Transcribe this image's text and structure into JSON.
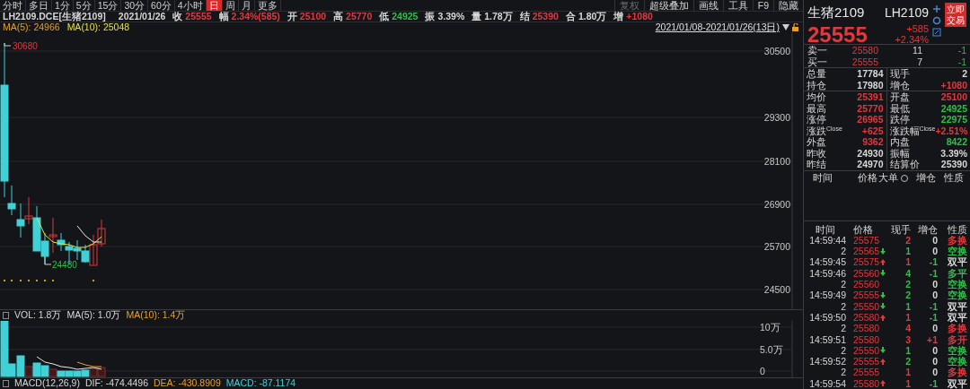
{
  "period_tabs": [
    {
      "label": "分时",
      "selected": false
    },
    {
      "label": "多日",
      "selected": false
    },
    {
      "label": "1分",
      "selected": false
    },
    {
      "label": "5分",
      "selected": false
    },
    {
      "label": "15分",
      "selected": false
    },
    {
      "label": "30分",
      "selected": false
    },
    {
      "label": "60分",
      "selected": false
    },
    {
      "label": "4小时",
      "selected": false
    },
    {
      "label": "日",
      "selected": true
    },
    {
      "label": "周",
      "selected": false
    },
    {
      "label": "月",
      "selected": false
    },
    {
      "label": "更多",
      "selected": false
    }
  ],
  "tools": [
    {
      "label": "复权",
      "disabled": true
    },
    {
      "label": "超级叠加",
      "disabled": false
    },
    {
      "label": "画线",
      "disabled": false
    },
    {
      "label": "工具",
      "disabled": false
    },
    {
      "label": "F9",
      "disabled": false
    },
    {
      "label": "隐藏",
      "disabled": false
    }
  ],
  "info_bar": {
    "symbol": "LH2109.DCE[生猪2109]",
    "date": "2021/01/26",
    "fields": [
      {
        "label": "收",
        "value": "25555",
        "color": "#e0393e"
      },
      {
        "label": "幅",
        "value": "2.34%(585)",
        "color": "#e0393e"
      },
      {
        "label": "开",
        "value": "25100",
        "color": "#e0393e"
      },
      {
        "label": "高",
        "value": "25770",
        "color": "#e0393e"
      },
      {
        "label": "低",
        "value": "24925",
        "color": "#2fbf4a"
      },
      {
        "label": "振",
        "value": "3.39%",
        "color": "#d8d8d8"
      },
      {
        "label": "量",
        "value": "1.78万",
        "color": "#d8d8d8"
      },
      {
        "label": "结",
        "value": "25390",
        "color": "#e0393e"
      },
      {
        "label": "合",
        "value": "1.80万",
        "color": "#d8d8d8"
      },
      {
        "label": "增",
        "value": "+1080",
        "color": "#e0393e"
      }
    ]
  },
  "ma_legend": [
    {
      "text": "MA(5): 24966",
      "color": "#e8a02a"
    },
    {
      "text": "MA(10): 25048",
      "color": "#e6e23a"
    }
  ],
  "date_range": "2021/01/08-2021/01/26(13日)",
  "price_axis": [
    "30500",
    "29300",
    "28100",
    "26900",
    "25700",
    "24500"
  ],
  "high_label": "30680",
  "low_label": "24480",
  "volume_legend": [
    {
      "text": "VOL: 1.8万",
      "color": "#d8d8d8"
    },
    {
      "text": "MA(5): 1.0万",
      "color": "#d8d8d8"
    },
    {
      "text": "MA(10): 1.4万",
      "color": "#e8a02a"
    }
  ],
  "volume_axis": [
    "10万",
    "5.0万",
    "0"
  ],
  "macd_legend": [
    {
      "text": "MACD(12,26,9)",
      "color": "#d8d8d8"
    },
    {
      "text": "DIF: -474.4496",
      "color": "#d8d8d8"
    },
    {
      "text": "DEA: -430.8909",
      "color": "#e8a02a"
    },
    {
      "text": "MACD: -87.1174",
      "color": "#3fd1d6"
    }
  ],
  "quote": {
    "name": "生猪2109",
    "code": "LH2109",
    "price": "25555",
    "change": "+585",
    "change_pct": "+2.34%",
    "trade_button": "立即交易",
    "order_book": [
      {
        "label": "卖一",
        "price": "25580",
        "qty": "11",
        "delta": "-1"
      },
      {
        "label": "买一",
        "price": "25555",
        "qty": "7",
        "delta": "-1"
      }
    ],
    "stats": [
      [
        {
          "label": "总量",
          "value": "17784",
          "color": "#d8d8d8"
        },
        {
          "label": "现手",
          "value": "2",
          "color": "#d8d8d8"
        }
      ],
      [
        {
          "label": "持仓",
          "value": "17980",
          "color": "#d8d8d8"
        },
        {
          "label": "增仓",
          "value": "+1080",
          "color": "#e0393e"
        }
      ],
      [
        {
          "label": "均价",
          "value": "25391",
          "color": "#e0393e"
        },
        {
          "label": "开盘",
          "value": "25100",
          "color": "#e0393e"
        }
      ],
      [
        {
          "label": "最高",
          "value": "25770",
          "color": "#e0393e"
        },
        {
          "label": "最低",
          "value": "24925",
          "color": "#2fbf4a"
        }
      ],
      [
        {
          "label": "涨停",
          "value": "26965",
          "color": "#e0393e"
        },
        {
          "label": "跌停",
          "value": "22975",
          "color": "#2fbf4a"
        }
      ],
      [
        {
          "label": "涨跌",
          "sup": "Close",
          "value": "+625",
          "color": "#e0393e"
        },
        {
          "label": "涨跌幅",
          "sup": "Close",
          "value": "+2.51%",
          "color": "#e0393e"
        }
      ],
      [
        {
          "label": "外盘",
          "value": "9362",
          "color": "#e0393e"
        },
        {
          "label": "内盘",
          "value": "8422",
          "color": "#2fbf4a"
        }
      ],
      [
        {
          "label": "昨收",
          "value": "24930",
          "color": "#d8d8d8"
        },
        {
          "label": "振幅",
          "value": "3.39%",
          "color": "#d8d8d8"
        }
      ],
      [
        {
          "label": "昨结",
          "value": "24970",
          "color": "#d8d8d8"
        },
        {
          "label": "结算价",
          "value": "25390",
          "color": "#d8d8d8"
        }
      ]
    ]
  },
  "big_orders": {
    "columns": [
      "时间",
      "价格",
      "大单",
      "增仓",
      "性质"
    ]
  },
  "trades": {
    "columns": [
      "时间",
      "价格",
      "现手",
      "增仓",
      "性质"
    ],
    "rows": [
      {
        "time": "14:59:44",
        "price": {
          "text": "25575",
          "kind": "flat"
        },
        "qty": {
          "text": "2",
          "color": "#e0393e"
        },
        "oi": {
          "text": "0",
          "color": "#d8d8d8"
        },
        "nature": {
          "text": "多换",
          "color": "#e0393e"
        }
      },
      {
        "time": "2",
        "price": {
          "text": "25565",
          "kind": "down"
        },
        "qty": {
          "text": "1",
          "color": "#2fbf4a"
        },
        "oi": {
          "text": "0",
          "color": "#d8d8d8"
        },
        "nature": {
          "text": "空换",
          "color": "#2fbf4a"
        }
      },
      {
        "time": "14:59:45",
        "price": {
          "text": "25575",
          "kind": "up"
        },
        "qty": {
          "text": "1",
          "color": "#e0393e"
        },
        "oi": {
          "text": "-1",
          "color": "#2fbf4a"
        },
        "nature": {
          "text": "双平",
          "color": "#d8d8d8"
        }
      },
      {
        "time": "14:59:46",
        "price": {
          "text": "25560",
          "kind": "down"
        },
        "qty": {
          "text": "4",
          "color": "#2fbf4a"
        },
        "oi": {
          "text": "-1",
          "color": "#2fbf4a"
        },
        "nature": {
          "text": "多平",
          "color": "#2fbf4a"
        }
      },
      {
        "time": "2",
        "price": {
          "text": "25560",
          "kind": "flat"
        },
        "qty": {
          "text": "2",
          "color": "#2fbf4a"
        },
        "oi": {
          "text": "0",
          "color": "#d8d8d8"
        },
        "nature": {
          "text": "空换",
          "color": "#2fbf4a"
        }
      },
      {
        "time": "14:59:49",
        "price": {
          "text": "25555",
          "kind": "down"
        },
        "qty": {
          "text": "2",
          "color": "#2fbf4a"
        },
        "oi": {
          "text": "0",
          "color": "#d8d8d8"
        },
        "nature": {
          "text": "空换",
          "color": "#2fbf4a"
        }
      },
      {
        "time": "2",
        "price": {
          "text": "25550",
          "kind": "down"
        },
        "qty": {
          "text": "1",
          "color": "#2fbf4a"
        },
        "oi": {
          "text": "-1",
          "color": "#2fbf4a"
        },
        "nature": {
          "text": "双平",
          "color": "#d8d8d8"
        }
      },
      {
        "time": "14:59:50",
        "price": {
          "text": "25580",
          "kind": "up"
        },
        "qty": {
          "text": "1",
          "color": "#e0393e"
        },
        "oi": {
          "text": "-1",
          "color": "#2fbf4a"
        },
        "nature": {
          "text": "双平",
          "color": "#d8d8d8"
        }
      },
      {
        "time": "2",
        "price": {
          "text": "25580",
          "kind": "flat"
        },
        "qty": {
          "text": "4",
          "color": "#e0393e"
        },
        "oi": {
          "text": "0",
          "color": "#d8d8d8"
        },
        "nature": {
          "text": "多换",
          "color": "#e0393e"
        }
      },
      {
        "time": "14:59:51",
        "price": {
          "text": "25580",
          "kind": "flat"
        },
        "qty": {
          "text": "3",
          "color": "#e0393e"
        },
        "oi": {
          "text": "+1",
          "color": "#e0393e"
        },
        "nature": {
          "text": "多开",
          "color": "#e0393e"
        }
      },
      {
        "time": "2",
        "price": {
          "text": "25550",
          "kind": "down"
        },
        "qty": {
          "text": "1",
          "color": "#2fbf4a"
        },
        "oi": {
          "text": "0",
          "color": "#d8d8d8"
        },
        "nature": {
          "text": "空换",
          "color": "#2fbf4a"
        }
      },
      {
        "time": "14:59:52",
        "price": {
          "text": "25555",
          "kind": "up"
        },
        "qty": {
          "text": "2",
          "color": "#2fbf4a"
        },
        "oi": {
          "text": "0",
          "color": "#d8d8d8"
        },
        "nature": {
          "text": "空换",
          "color": "#2fbf4a"
        }
      },
      {
        "time": "2",
        "price": {
          "text": "25555",
          "kind": "flat"
        },
        "qty": {
          "text": "1",
          "color": "#e0393e"
        },
        "oi": {
          "text": "0",
          "color": "#d8d8d8"
        },
        "nature": {
          "text": "多换",
          "color": "#e0393e"
        }
      },
      {
        "time": "14:59:54",
        "price": {
          "text": "25580",
          "kind": "up"
        },
        "qty": {
          "text": "1",
          "color": "#e0393e"
        },
        "oi": {
          "text": "-1",
          "color": "#2fbf4a"
        },
        "nature": {
          "text": "双平",
          "color": "#d8d8d8"
        }
      }
    ]
  }
}
